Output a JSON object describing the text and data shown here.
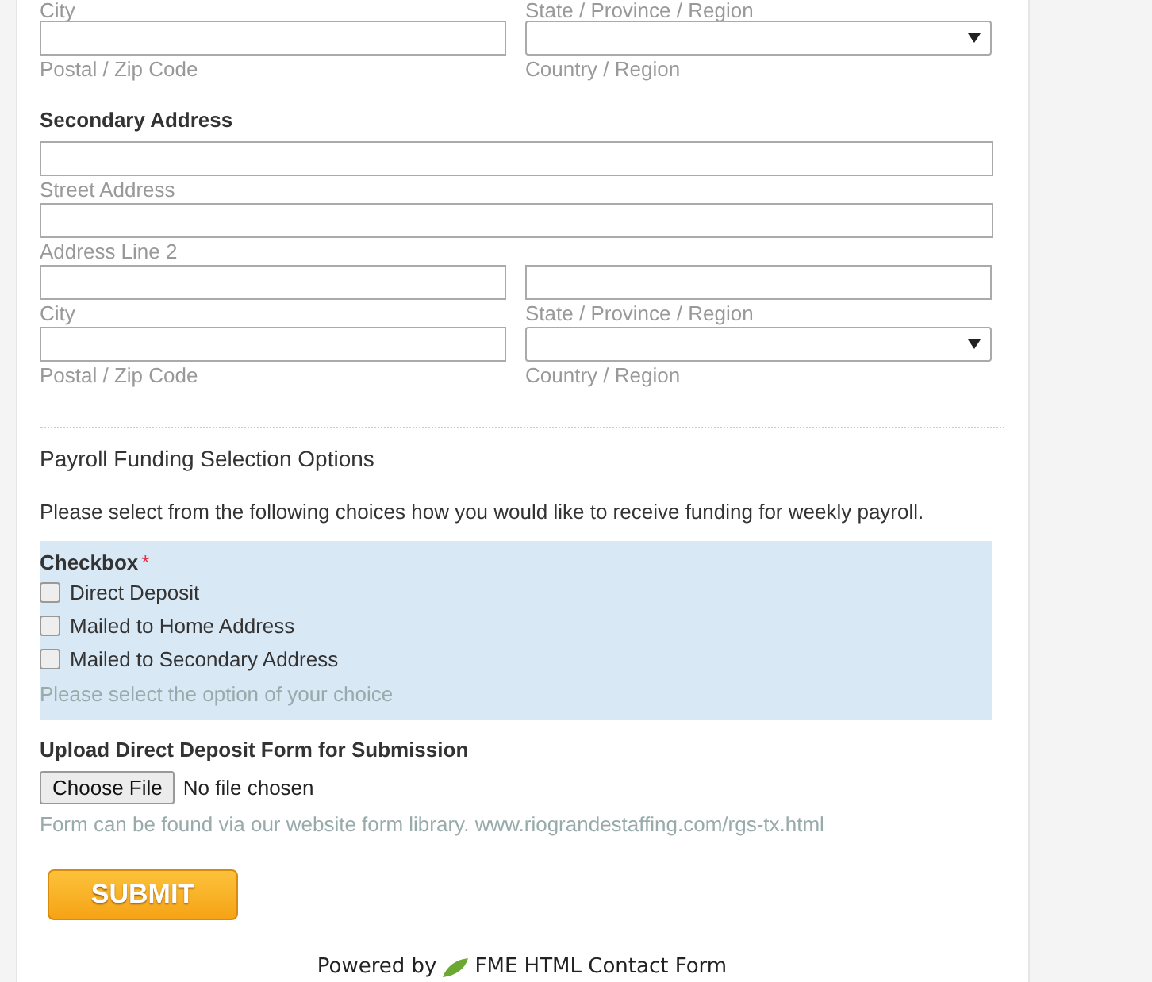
{
  "home_address_tail": {
    "cut_labels": [
      "City",
      "State / Province / Region"
    ],
    "rows": [
      [
        {
          "kind": "text",
          "label": "Postal / Zip Code"
        },
        {
          "kind": "select",
          "label": "Country / Region"
        }
      ]
    ]
  },
  "secondary_address": {
    "title": "Secondary Address",
    "rows": [
      [
        {
          "kind": "text",
          "label": "Street Address"
        }
      ],
      [
        {
          "kind": "text",
          "label": "Address Line 2"
        }
      ],
      [
        {
          "kind": "text",
          "label": "City"
        },
        {
          "kind": "text",
          "label": "State / Province / Region"
        }
      ],
      [
        {
          "kind": "text",
          "label": "Postal / Zip Code"
        },
        {
          "kind": "select",
          "label": "Country / Region"
        }
      ]
    ]
  },
  "payroll": {
    "title": "Payroll Funding Selection Options",
    "intro": "Please select from the following choices how you would like to receive funding for weekly payroll.",
    "checkbox_group": {
      "label": "Checkbox",
      "required_mark": "*",
      "options": [
        {
          "label": "Direct Deposit",
          "checked": false
        },
        {
          "label": "Mailed to Home Address",
          "checked": false
        },
        {
          "label": "Mailed to Secondary Address",
          "checked": false
        }
      ],
      "hint": "Please select the option of your choice"
    }
  },
  "upload": {
    "label": "Upload Direct Deposit Form for Submission",
    "button": "Choose File",
    "status": "No file chosen",
    "hint": "Form can be found via our website form library. www.riograndestaffing.com/rgs-tx.html"
  },
  "submit": "SUBMIT",
  "footer": {
    "prefix": "Powered by",
    "link": "FME HTML Contact Form"
  }
}
